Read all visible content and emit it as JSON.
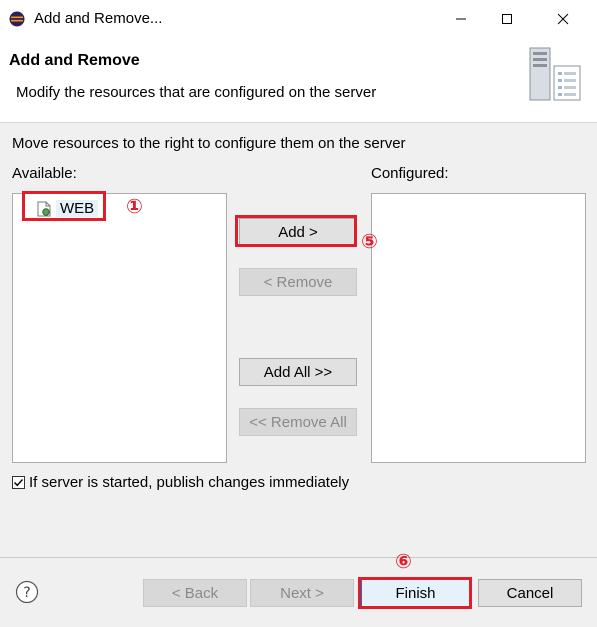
{
  "window": {
    "title": "Add and Remove...",
    "controls": {
      "minimize_icon": "minimize-icon",
      "maximize_icon": "maximize-icon",
      "close_icon": "close-icon"
    }
  },
  "header": {
    "title": "Add and Remove",
    "description": "Modify the resources that are configured on the server",
    "icon": "server-icon"
  },
  "body": {
    "instruction": "Move resources to the right to configure them on the server",
    "available": {
      "label": "Available:",
      "items": [
        {
          "label": "WEB",
          "icon": "web-project-icon",
          "selected": true
        }
      ]
    },
    "configured": {
      "label": "Configured:",
      "items": []
    },
    "buttons": {
      "add": "Add >",
      "remove": "< Remove",
      "add_all": "Add All >>",
      "remove_all": "<< Remove All"
    },
    "publish_checkbox": {
      "label": "If server is started, publish changes immediately",
      "checked": true
    }
  },
  "footer": {
    "help_icon": "help-icon",
    "back": "< Back",
    "next": "Next >",
    "finish": "Finish",
    "cancel": "Cancel"
  },
  "annotations": {
    "step_web": "①",
    "step_add": "⑤",
    "step_finish": "⑥",
    "highlight_color": "#e11d2a"
  }
}
